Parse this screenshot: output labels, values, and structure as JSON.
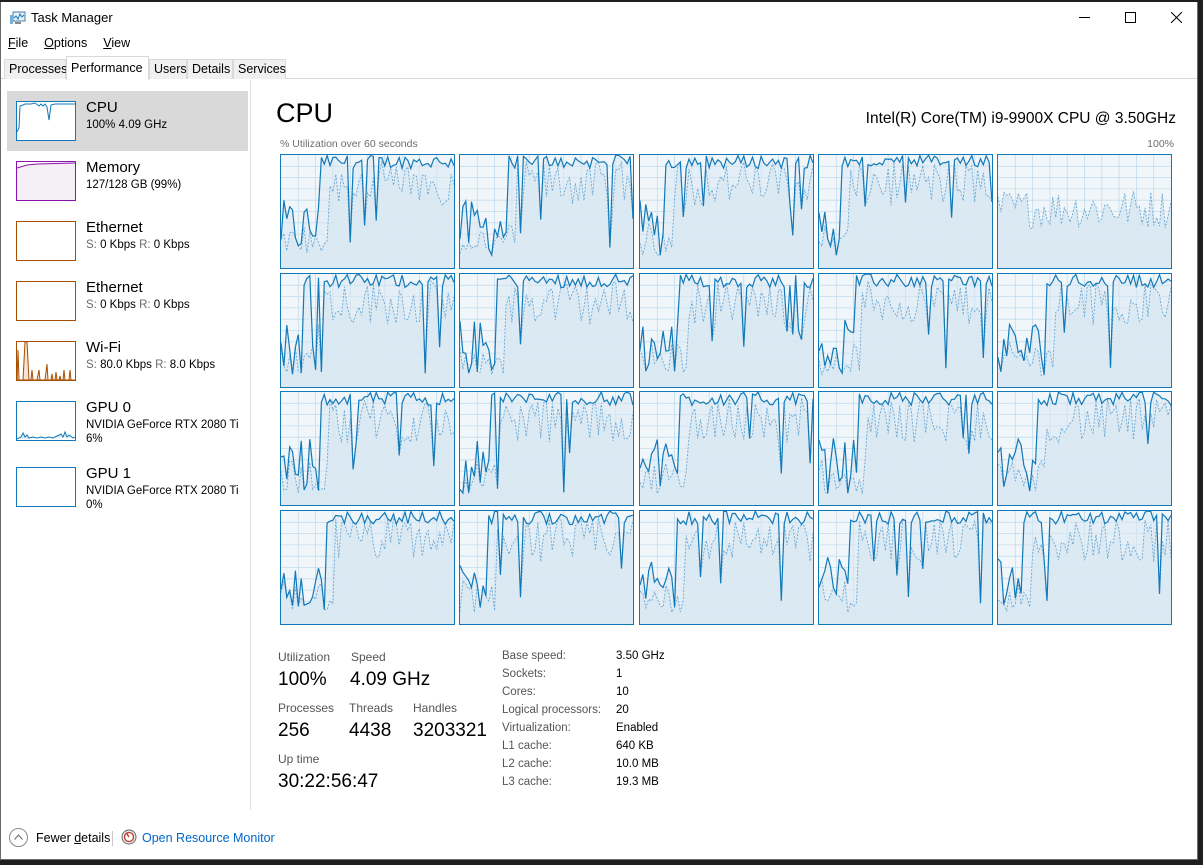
{
  "window": {
    "title": "Task Manager",
    "controls": {
      "minimize": "minimize",
      "maximize": "maximize",
      "close": "close"
    }
  },
  "menu": [
    {
      "label": "File",
      "accel": "F",
      "rest": "ile"
    },
    {
      "label": "Options",
      "accel": "O",
      "rest": "ptions"
    },
    {
      "label": "View",
      "accel": "V",
      "rest": "iew"
    }
  ],
  "tabs": [
    {
      "label": "Processes",
      "active": false
    },
    {
      "label": "Performance",
      "active": true
    },
    {
      "label": "Users",
      "active": false
    },
    {
      "label": "Details",
      "active": false
    },
    {
      "label": "Services",
      "active": false
    }
  ],
  "sidebar": {
    "items": [
      {
        "title": "CPU",
        "sub": "100% 4.09 GHz",
        "color": "#1179b8",
        "selected": true
      },
      {
        "title": "Memory",
        "sub": "127/128 GB (99%)",
        "color": "#8b12ae",
        "selected": false
      },
      {
        "title": "Ethernet",
        "sub_s_label": "S:",
        "sub_s": "0 Kbps",
        "sub_r_label": "R:",
        "sub_r": "0 Kbps",
        "color": "#a74f01",
        "selected": false
      },
      {
        "title": "Ethernet",
        "sub_s_label": "S:",
        "sub_s": "0 Kbps",
        "sub_r_label": "R:",
        "sub_r": "0 Kbps",
        "color": "#a74f01",
        "selected": false
      },
      {
        "title": "Wi-Fi",
        "sub_s_label": "S:",
        "sub_s": "80.0 Kbps",
        "sub_r_label": "R:",
        "sub_r": "8.0 Kbps",
        "color": "#a74f01",
        "selected": false
      },
      {
        "title": "GPU 0",
        "sub": "NVIDIA GeForce RTX 2080 Ti",
        "sub2": "6%",
        "color": "#1179b8",
        "selected": false
      },
      {
        "title": "GPU 1",
        "sub": "NVIDIA GeForce RTX 2080 Ti",
        "sub2": "0%",
        "color": "#1179b8",
        "selected": false
      }
    ]
  },
  "main": {
    "title": "CPU",
    "model": "Intel(R) Core(TM) i9-9900X CPU @ 3.50GHz",
    "graph_label": "% Utilization over 60 seconds",
    "graph_max": "100%",
    "logical_processor_count": 20,
    "graph_colors": {
      "line": "#1179b8",
      "fill": "#d9e8f3",
      "grid": "#c3dcee",
      "bg": "#f1f6fa"
    }
  },
  "stats": {
    "utilization": {
      "label": "Utilization",
      "value": "100%"
    },
    "speed": {
      "label": "Speed",
      "value": "4.09 GHz"
    },
    "processes": {
      "label": "Processes",
      "value": "256"
    },
    "threads": {
      "label": "Threads",
      "value": "4438"
    },
    "handles": {
      "label": "Handles",
      "value": "3203321"
    },
    "uptime": {
      "label": "Up time",
      "value": "30:22:56:47"
    }
  },
  "specs": [
    {
      "key": "Base speed:",
      "value": "3.50 GHz"
    },
    {
      "key": "Sockets:",
      "value": "1"
    },
    {
      "key": "Cores:",
      "value": "10"
    },
    {
      "key": "Logical processors:",
      "value": "20"
    },
    {
      "key": "Virtualization:",
      "value": "Enabled"
    },
    {
      "key": "L1 cache:",
      "value": "640 KB"
    },
    {
      "key": "L2 cache:",
      "value": "10.0 MB"
    },
    {
      "key": "L3 cache:",
      "value": "19.3 MB"
    }
  ],
  "footer": {
    "fewer_details": "Fewer details",
    "fewer_accel_before": "Fewer ",
    "fewer_accel": "d",
    "fewer_accel_after": "etails",
    "resource_monitor": "Open Resource Monitor"
  }
}
